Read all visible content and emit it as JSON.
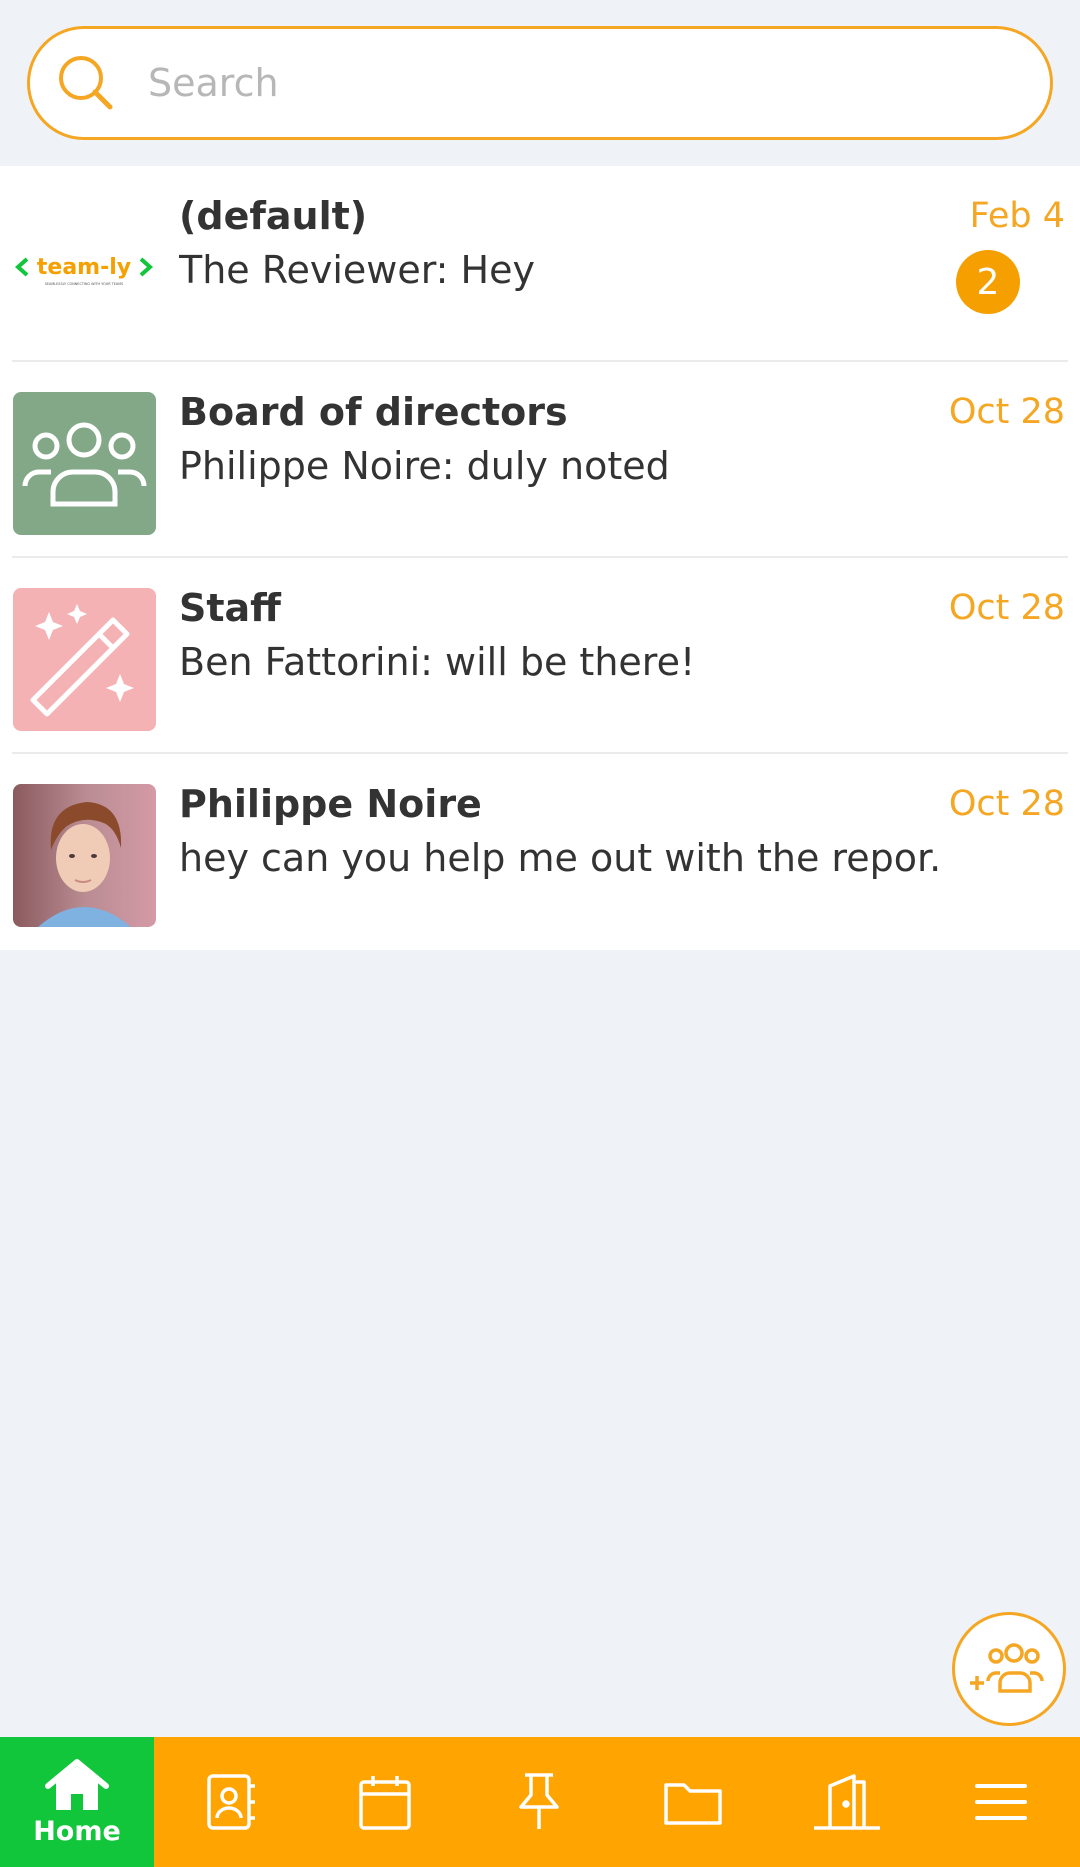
{
  "search": {
    "placeholder": "Search"
  },
  "conversations": [
    {
      "title": "(default)",
      "preview": "The Reviewer: Hey",
      "date": "Feb 4",
      "unread": "2",
      "avatar": "team-ly-logo",
      "logo_text": "team-ly",
      "logo_tagline": "SEAMLESSLY CONNECTING WITH YOUR TEAMS"
    },
    {
      "title": "Board of directors",
      "preview": "Philippe Noire: duly noted",
      "date": "Oct 28",
      "avatar": "group-icon"
    },
    {
      "title": "Staff",
      "preview": "Ben Fattorini: will be there!",
      "date": "Oct 28",
      "avatar": "magic-wand-icon"
    },
    {
      "title": "Philippe Noire",
      "preview": "hey can you help me out with the repor...",
      "date": "Oct 28",
      "avatar": "user-photo"
    }
  ],
  "fab": {
    "icon": "add-group-icon"
  },
  "bottom_nav": {
    "items": [
      {
        "label": "Home",
        "icon": "home-icon",
        "active": true
      },
      {
        "icon": "contacts-icon"
      },
      {
        "icon": "calendar-icon"
      },
      {
        "icon": "pin-icon"
      },
      {
        "icon": "folder-icon"
      },
      {
        "icon": "door-icon"
      },
      {
        "icon": "menu-icon"
      }
    ]
  },
  "colors": {
    "accent": "#f5a623",
    "nav_bg": "#ffa400",
    "nav_active": "#12c63b",
    "board_avatar": "#82a888",
    "staff_avatar": "#f4b2b5",
    "background": "#eff2f7"
  }
}
